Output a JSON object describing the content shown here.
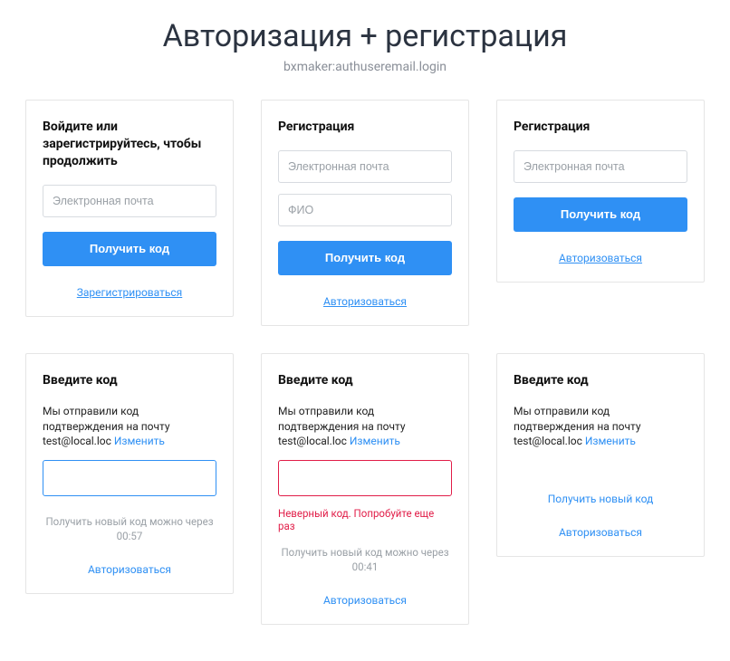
{
  "page": {
    "title": "Авторизация + регистрация",
    "subtitle": "bxmaker:authuseremail.login"
  },
  "common": {
    "email_placeholder": "Электронная почта",
    "fio_placeholder": "ФИО",
    "get_code": "Получить код",
    "register_link": "Зарегистрироваться",
    "login_link": "Авторизоваться",
    "change": "Изменить",
    "sent_prefix": "Мы отправили код подтверждения на почту ",
    "get_new_code": "Получить новый код",
    "resend_prefix": "Получить новый код можно через "
  },
  "cards": {
    "login": {
      "title": "Войдите или зарегистрируйтесь, чтобы продолжить"
    },
    "register_full": {
      "title": "Регистрация"
    },
    "register_short": {
      "title": "Регистрация"
    },
    "code1": {
      "title": "Введите код",
      "email": "test@local.loc",
      "timer": "00:57"
    },
    "code2": {
      "title": "Введите код",
      "email": "test@local.loc",
      "timer": "00:41",
      "error": "Неверный код. Попробуйте еще раз"
    },
    "code3": {
      "title": "Введите код",
      "email": "test@local.loc"
    }
  }
}
